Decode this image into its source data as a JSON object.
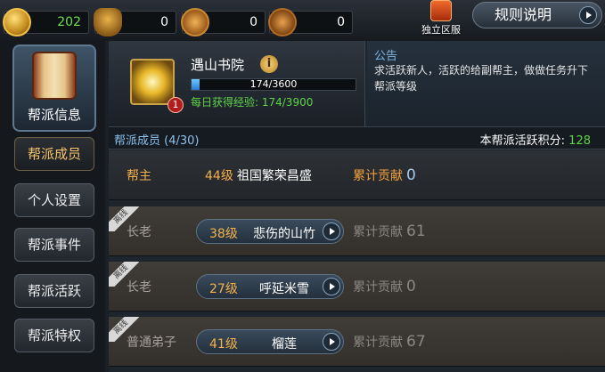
{
  "resources": [
    {
      "icon": "gold-coin-icon",
      "value": "202"
    },
    {
      "icon": "helmet-icon",
      "value": "0"
    },
    {
      "icon": "medal-icon",
      "value": "0"
    },
    {
      "icon": "scroll-token-icon",
      "value": "0"
    }
  ],
  "server_button": {
    "label": "独立区服",
    "icon": "server-icon"
  },
  "rules_button": {
    "label": "规则说明"
  },
  "nav": {
    "main_label": "帮派信息",
    "items": [
      {
        "label": "帮派成员",
        "active": true
      },
      {
        "label": "个人设置",
        "active": false
      },
      {
        "label": "帮派事件",
        "active": false
      },
      {
        "label": "帮派活跃",
        "active": false
      },
      {
        "label": "帮派特权",
        "active": false
      }
    ]
  },
  "guild": {
    "name": "遇山书院",
    "level": "1",
    "exp_text": "174/3600",
    "exp_current": 174,
    "exp_max": 3600,
    "daily_exp": "每日获得经验: 174/3900"
  },
  "notice": {
    "title": "公告",
    "text": "求活跃新人，活跃的给副帮主，做做任务升下帮派等级"
  },
  "members_header": {
    "count_label": "帮派成员 (4/30)",
    "activity_label": "本帮派活跃积分: ",
    "activity_value": "128"
  },
  "members": [
    {
      "rank": "帮主",
      "level": "44级",
      "name": "祖国繁荣昌盛",
      "contrib_label": "累计贡献",
      "contrib": "0",
      "offline": false
    },
    {
      "rank": "长老",
      "level": "38级",
      "name": "悲伤的山竹",
      "contrib_label": "累计贡献",
      "contrib": "61",
      "offline": true,
      "ribbon": "离线"
    },
    {
      "rank": "长老",
      "level": "27级",
      "name": "呼延米雪",
      "contrib_label": "累计贡献",
      "contrib": "0",
      "offline": true,
      "ribbon": "离线"
    },
    {
      "rank": "普通弟子",
      "level": "41级",
      "name": "榴莲",
      "contrib_label": "累计贡献",
      "contrib": "67",
      "offline": true,
      "ribbon": "离线"
    }
  ]
}
